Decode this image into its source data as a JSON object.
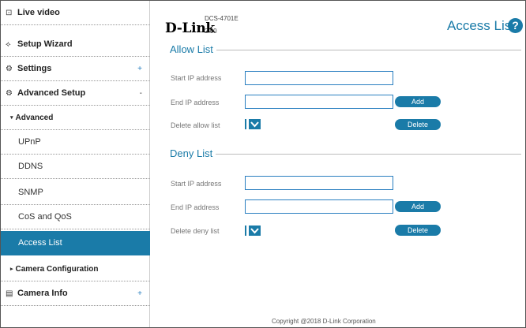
{
  "sidebar": {
    "items": [
      {
        "label": "Live video",
        "icon": "live-video-icon",
        "glyph": "⊡"
      },
      {
        "label": "Setup Wizard",
        "icon": "wizard-wand-icon",
        "glyph": "⟡"
      },
      {
        "label": "Settings",
        "icon": "settings-gear-icon",
        "glyph": "⚙",
        "expander": "+"
      },
      {
        "label": "Advanced Setup",
        "icon": "advanced-setup-icon",
        "glyph": "⚙",
        "expander": "-"
      },
      {
        "label": "Advanced",
        "expanded": true
      },
      {
        "label": "UPnP"
      },
      {
        "label": "DDNS"
      },
      {
        "label": "SNMP"
      },
      {
        "label": "CoS and QoS"
      },
      {
        "label": "Access List",
        "active": true
      },
      {
        "label": "Camera Configuration",
        "expanded": false
      },
      {
        "label": "Camera Info",
        "icon": "camera-info-icon",
        "glyph": "▤",
        "expander": "+"
      }
    ]
  },
  "header": {
    "brand": "D-Link",
    "model": "DCS-4701E",
    "firmware": "2.00",
    "page_title": "Access List",
    "help_glyph": "?"
  },
  "allow_list": {
    "title": "Allow List",
    "start_label": "Start IP address",
    "start_value": "",
    "end_label": "End IP address",
    "end_value": "",
    "add_label": "Add",
    "delete_label_text": "Delete allow list",
    "delete_button": "Delete"
  },
  "deny_list": {
    "title": "Deny List",
    "start_label": "Start IP address",
    "start_value": "",
    "end_label": "End IP address",
    "end_value": "",
    "add_label": "Add",
    "delete_label_text": "Delete deny list",
    "delete_button": "Delete"
  },
  "footer": {
    "copyright": "Copyright @2018 D-Link Corporation"
  },
  "colors": {
    "accent": "#1a7ba8",
    "input_border": "#2a7fc0"
  }
}
